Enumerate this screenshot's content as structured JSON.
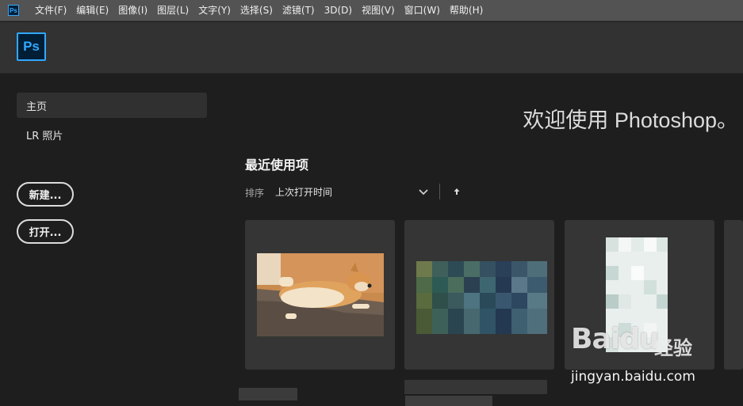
{
  "menubar": {
    "app_icon_label": "Ps",
    "items": [
      "文件(F)",
      "编辑(E)",
      "图像(I)",
      "图层(L)",
      "文字(Y)",
      "选择(S)",
      "滤镜(T)",
      "3D(D)",
      "视图(V)",
      "窗口(W)",
      "帮助(H)"
    ]
  },
  "header": {
    "logo_label": "Ps"
  },
  "sidebar": {
    "items": [
      {
        "label": "主页",
        "active": true
      },
      {
        "label": "LR 照片",
        "active": false
      }
    ],
    "new_button": "新建...",
    "open_button": "打开..."
  },
  "main": {
    "welcome": "欢迎使用 Photoshop。",
    "recent_title": "最近使用项",
    "sort_label": "排序",
    "sort_value": "上次打开时间",
    "sort_icon": "chevron-down-icon",
    "order_icon": "arrow-up-icon"
  },
  "watermark": {
    "brand": "Bai",
    "brand_suffix": "du",
    "cn": "经验",
    "url": "jingyan.baidu.com"
  },
  "colors": {
    "menubar_bg": "#535353",
    "header_bg": "#323232",
    "body_bg": "#1e1e1e",
    "card_bg": "#353535",
    "ps_blue": "#31a8ff",
    "ps_dark": "#001e36"
  }
}
